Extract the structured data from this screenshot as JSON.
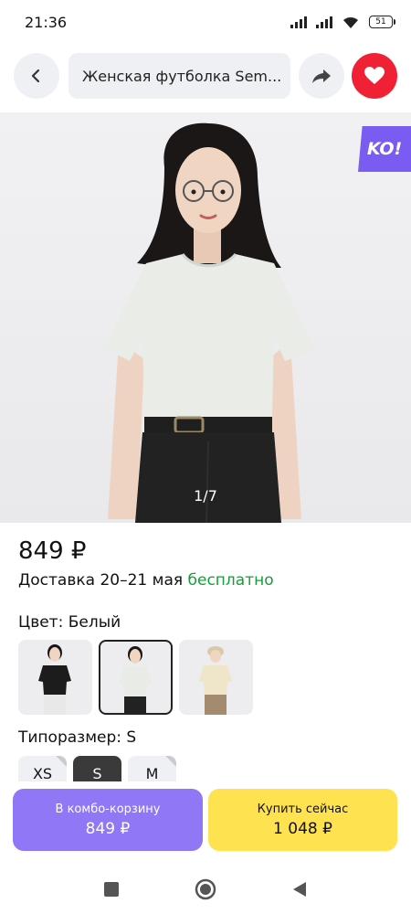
{
  "status_bar": {
    "time": "21:36",
    "battery": "51"
  },
  "search": {
    "query": "Женская футболка Sem..."
  },
  "hero": {
    "badge": "KO!",
    "counter": "1/7"
  },
  "product": {
    "price": "849 ₽",
    "delivery_prefix": "Доставка 20–21 мая",
    "delivery_free": "бесплатно"
  },
  "color": {
    "label": "Цвет: Белый",
    "options": [
      {
        "name": "black",
        "shirt": "#1c1c1c",
        "selected": false
      },
      {
        "name": "white",
        "shirt": "#e8ebe6",
        "selected": true
      },
      {
        "name": "beige",
        "shirt": "#efe5c8",
        "selected": false
      }
    ]
  },
  "size": {
    "label": "Типоразмер: S",
    "options": [
      "XS",
      "S",
      "M"
    ],
    "selected": "S"
  },
  "actions": {
    "combo_label": "В комбо-корзину",
    "combo_price": "849 ₽",
    "buy_label": "Купить сейчас",
    "buy_price": "1 048 ₽"
  },
  "colors": {
    "favorite": "#f02035",
    "combo_button": "#8f77f5",
    "buy_button": "#ffe24f",
    "free_delivery": "#12a135",
    "badge": "#7b5cf2"
  },
  "icons": [
    "back-icon",
    "share-icon",
    "heart-icon",
    "wifi-icon",
    "signal-icon",
    "battery-icon",
    "home-icon",
    "recents-icon",
    "back-nav-icon"
  ]
}
